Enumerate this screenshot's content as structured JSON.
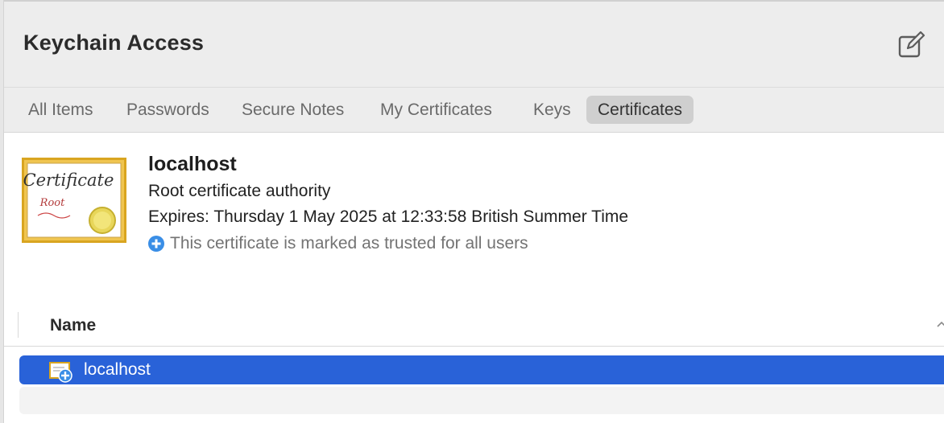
{
  "app": {
    "title": "Keychain Access"
  },
  "toolbar": {
    "compose_icon": "square-and-pencil-icon"
  },
  "tabs": [
    {
      "label": "All Items",
      "active": false
    },
    {
      "label": "Passwords",
      "active": false
    },
    {
      "label": "Secure Notes",
      "active": false
    },
    {
      "label": "My Certificates",
      "active": false
    },
    {
      "label": "Keys",
      "active": false
    },
    {
      "label": "Certificates",
      "active": true
    }
  ],
  "certificate": {
    "image_icon": "certificate-icon",
    "image_title": "Certificate",
    "image_subtitle": "Root",
    "name": "localhost",
    "kind": "Root certificate authority",
    "expires": "Expires: Thursday 1 May 2025 at 12:33:58 British Summer Time",
    "trust_icon": "plus-circle-icon",
    "trust_text": "This certificate is marked as trusted for all users"
  },
  "list": {
    "columns": [
      {
        "label": "Name"
      }
    ],
    "rows": [
      {
        "name": "localhost",
        "icon": "certificate-trusted-icon",
        "selected": true
      }
    ]
  },
  "colors": {
    "selection": "#2962d8",
    "trust_icon": "#3a8ee6",
    "cert_gold": "#d9a520"
  }
}
